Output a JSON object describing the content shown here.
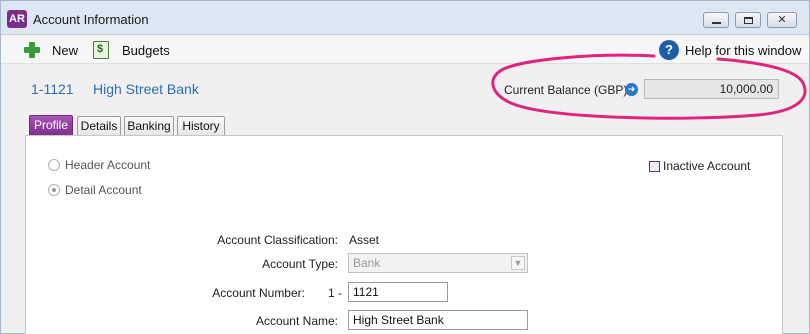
{
  "window": {
    "app_icon": "AR",
    "title": "Account Information",
    "controls": [
      "minimize-icon",
      "maximize-icon",
      "close-icon"
    ],
    "accent_color": "#7b2d8e",
    "annotation_color": "#e0257a"
  },
  "toolbar": {
    "new_label": "New",
    "budgets_label": "Budgets",
    "help_label": "Help for this window",
    "help_icon_glyph": "?"
  },
  "header": {
    "account_number": "1-1121",
    "account_name": "High Street Bank",
    "balance_label": "Current Balance (GBP):",
    "balance_value": "10,000.00"
  },
  "tabs": [
    {
      "label": "Profile",
      "active": true
    },
    {
      "label": "Details",
      "active": false
    },
    {
      "label": "Banking",
      "active": false
    },
    {
      "label": "History",
      "active": false
    }
  ],
  "profile": {
    "header_account_label": "Header Account",
    "detail_account_label": "Detail Account",
    "selected_account_kind": "Detail Account",
    "inactive_label": "Inactive Account",
    "inactive_checked": false,
    "classification_label": "Account Classification:",
    "classification_value": "Asset",
    "type_label": "Account Type:",
    "type_value": "Bank",
    "number_label": "Account Number:",
    "number_prefix": "1 -",
    "number_value": "1121",
    "name_label": "Account Name:",
    "name_value": "High Street Bank"
  }
}
